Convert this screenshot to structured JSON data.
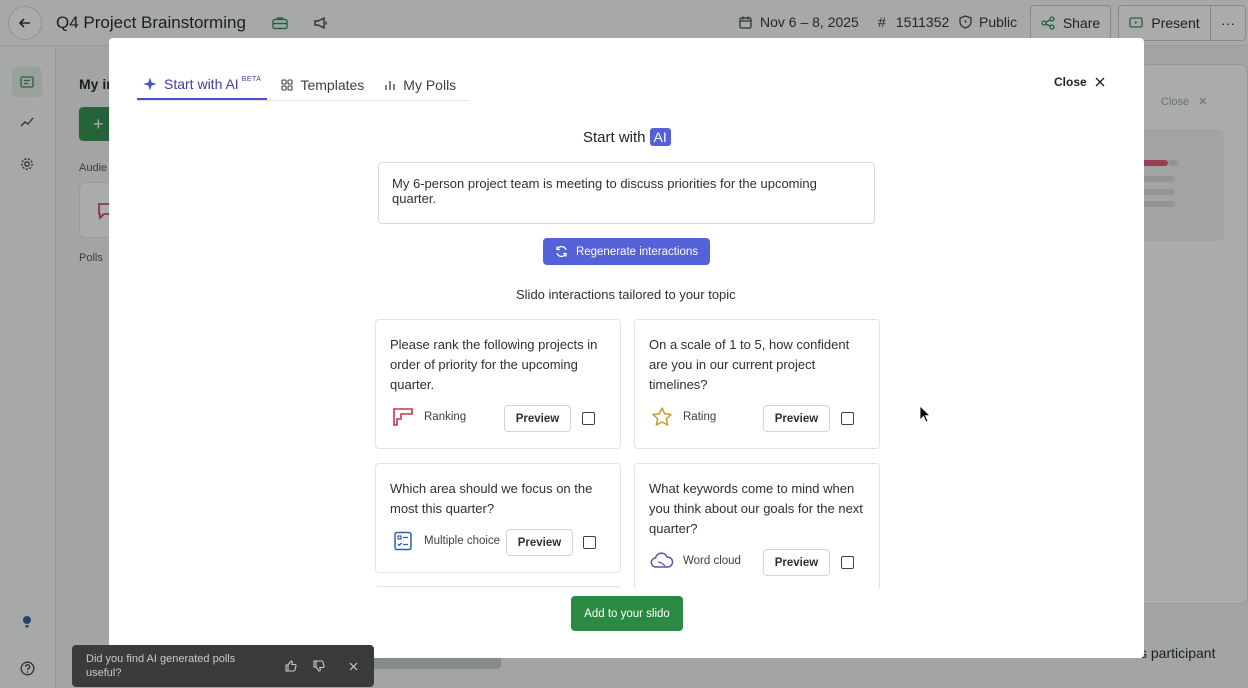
{
  "app": {
    "title": "Q4 Project Brainstorming",
    "date_range": "Nov 6 – 8, 2025",
    "event_code": "1511352",
    "visibility": "Public",
    "share_label": "Share",
    "present_label": "Present",
    "more_label": "···"
  },
  "left_panel": {
    "title": "My in",
    "add_label": "+",
    "audience_label": "Audie",
    "polls_label": "Polls"
  },
  "right_panel": {
    "close_label": "Close",
    "participant_text": "s participant"
  },
  "modal": {
    "tabs": [
      {
        "label": "Start with AI",
        "badge": "BETA",
        "active": true
      },
      {
        "label": "Templates",
        "active": false
      },
      {
        "label": "My Polls",
        "active": false
      }
    ],
    "close_label": "Close",
    "heading_prefix": "Start with",
    "heading_badge": "AI",
    "prompt_text": "My 6-person project team is meeting to discuss priorities for the upcoming quarter.",
    "regenerate_label": "Regenerate interactions",
    "tailored_heading": "Slido interactions tailored to your topic",
    "preview_label": "Preview",
    "add_label": "Add to your slido",
    "cards": [
      {
        "question": "Please rank the following projects in order of priority for the upcoming quarter.",
        "type": "Ranking",
        "icon": "ranking-icon",
        "checked": false
      },
      {
        "question": "On a scale of 1 to 5, how confident are you in our current project timelines?",
        "type": "Rating",
        "icon": "star-icon",
        "checked": false
      },
      {
        "question": "Which area should we focus on the most this quarter?",
        "type": "Multiple choice",
        "icon": "multiple-choice-icon",
        "checked": false
      },
      {
        "question": "What keywords come to mind when you think about our goals for the next quarter?",
        "type": "Word cloud",
        "icon": "word-cloud-icon",
        "checked": false
      }
    ]
  },
  "toast": {
    "text": "Did you find AI generated polls useful?"
  },
  "colors": {
    "ai_accent": "#5561d6",
    "primary_green": "#2a8a44",
    "ranking_red": "#c8314f"
  }
}
